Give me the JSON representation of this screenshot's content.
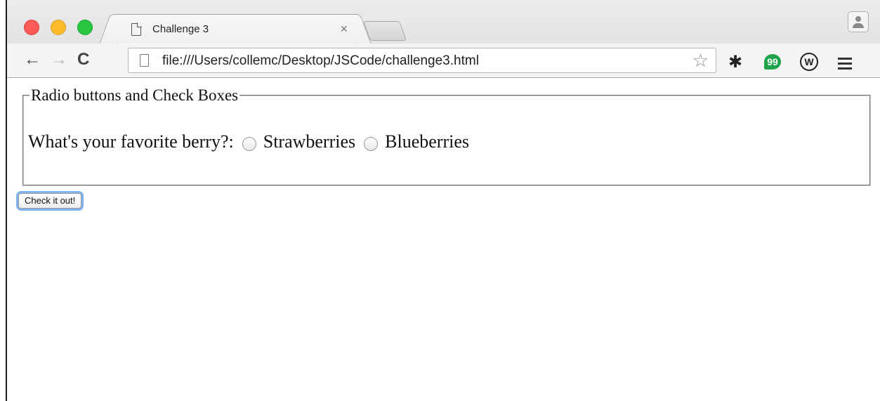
{
  "browser": {
    "tab": {
      "title": "Challenge 3",
      "close_glyph": "×",
      "icon": "page-icon"
    },
    "nav": {
      "back_glyph": "←",
      "forward_glyph": "→",
      "reload_glyph": "C"
    },
    "address_bar": {
      "url": "file:///Users/collemc/Desktop/JSCode/challenge3.html",
      "bookmark_glyph": "☆"
    },
    "extensions": {
      "settings_glyph": "✱",
      "chat_glyph": "99",
      "w_glyph": "W"
    }
  },
  "page": {
    "fieldset_legend": "Radio buttons and Check Boxes",
    "question_label": "What's your favorite berry?:",
    "options": [
      {
        "label": "Strawberries"
      },
      {
        "label": "Blueberries"
      }
    ],
    "submit_button": "Check it out!"
  }
}
